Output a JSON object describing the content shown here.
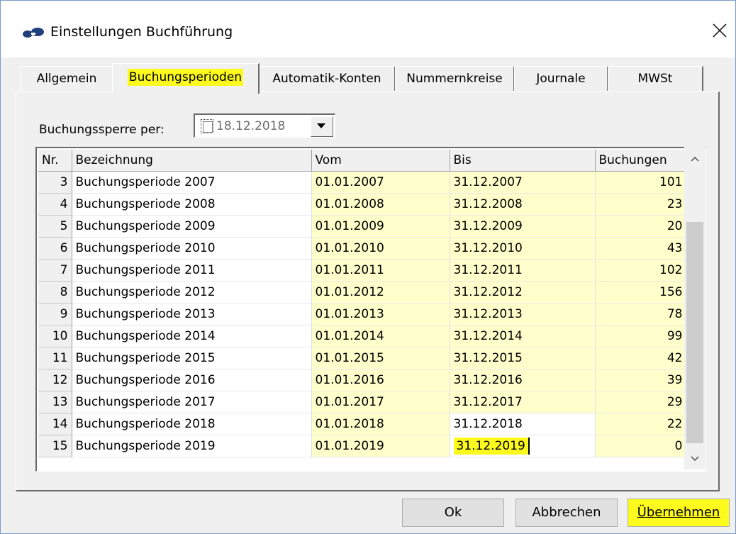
{
  "window": {
    "title": "Einstellungen Buchführung"
  },
  "tabs": [
    {
      "label": "Allgemein"
    },
    {
      "label": "Buchungsperioden"
    },
    {
      "label": "Automatik-Konten"
    },
    {
      "label": "Nummernkreise"
    },
    {
      "label": "Journale"
    },
    {
      "label": "MWSt"
    }
  ],
  "lock": {
    "label": "Buchungssperre per:",
    "date": "18.12.2018",
    "checked": false
  },
  "table": {
    "headers": [
      "Nr.",
      "Bezeichnung",
      "Vom",
      "Bis",
      "Buchungen"
    ],
    "rows": [
      {
        "nr": "3",
        "name": "Buchungsperiode 2007",
        "from": "01.01.2007",
        "to": "31.12.2007",
        "count": "101"
      },
      {
        "nr": "4",
        "name": "Buchungsperiode 2008",
        "from": "01.01.2008",
        "to": "31.12.2008",
        "count": "23"
      },
      {
        "nr": "5",
        "name": "Buchungsperiode 2009",
        "from": "01.01.2009",
        "to": "31.12.2009",
        "count": "20"
      },
      {
        "nr": "6",
        "name": "Buchungsperiode 2010",
        "from": "01.01.2010",
        "to": "31.12.2010",
        "count": "43"
      },
      {
        "nr": "7",
        "name": "Buchungsperiode 2011",
        "from": "01.01.2011",
        "to": "31.12.2011",
        "count": "102"
      },
      {
        "nr": "8",
        "name": "Buchungsperiode 2012",
        "from": "01.01.2012",
        "to": "31.12.2012",
        "count": "156"
      },
      {
        "nr": "9",
        "name": "Buchungsperiode 2013",
        "from": "01.01.2013",
        "to": "31.12.2013",
        "count": "78"
      },
      {
        "nr": "10",
        "name": "Buchungsperiode 2014",
        "from": "01.01.2014",
        "to": "31.12.2014",
        "count": "99"
      },
      {
        "nr": "11",
        "name": "Buchungsperiode 2015",
        "from": "01.01.2015",
        "to": "31.12.2015",
        "count": "42"
      },
      {
        "nr": "12",
        "name": "Buchungsperiode 2016",
        "from": "01.01.2016",
        "to": "31.12.2016",
        "count": "39"
      },
      {
        "nr": "13",
        "name": "Buchungsperiode 2017",
        "from": "01.01.2017",
        "to": "31.12.2017",
        "count": "29"
      },
      {
        "nr": "14",
        "name": "Buchungsperiode 2018",
        "from": "01.01.2018",
        "to": "31.12.2018",
        "count": "22"
      },
      {
        "nr": "15",
        "name": "Buchungsperiode 2019",
        "from": "01.01.2019",
        "to": "31.12.2019",
        "count": "0"
      }
    ]
  },
  "buttons": {
    "ok": "Ok",
    "cancel": "Abbrechen",
    "apply": "Übernehmen"
  },
  "colors": {
    "highlight": "#fdfa1d",
    "editable_cell": "#ffffcc"
  },
  "icons": {
    "app": "app-logo-icon",
    "close": "close-icon",
    "dropdown": "chevron-down-icon",
    "scroll_up": "chevron-up-icon",
    "scroll_down": "chevron-down-icon"
  }
}
